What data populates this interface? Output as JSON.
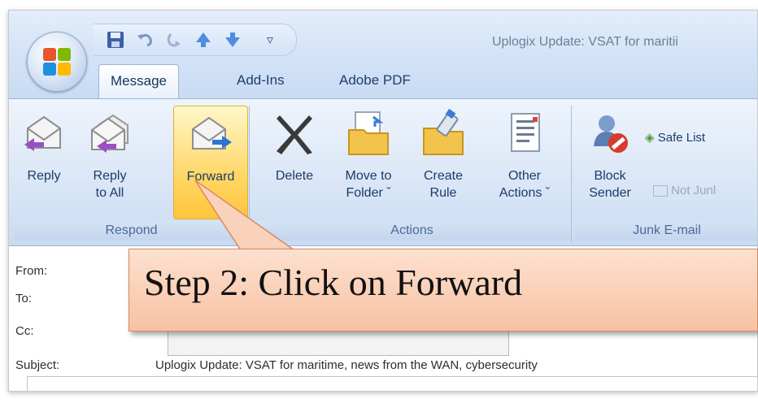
{
  "window": {
    "title": "Uplogix Update: VSAT for maritii"
  },
  "quick_access": {
    "icons": [
      "save-icon",
      "undo-icon",
      "redo-icon",
      "previous-item-icon",
      "next-item-icon",
      "customize-qat-icon"
    ],
    "customize_glyph": "▿"
  },
  "tabs": [
    {
      "label": "Message",
      "active": true
    },
    {
      "label": "Add-Ins",
      "active": false
    },
    {
      "label": "Adobe PDF",
      "active": false
    }
  ],
  "ribbon": {
    "respond": {
      "label": "Respond",
      "reply": "Reply",
      "reply_all": "Reply\nto All",
      "forward": "Forward"
    },
    "actions": {
      "label": "Actions",
      "delete": "Delete",
      "move_to_folder": "Move to\nFolder ˇ",
      "create_rule": "Create\nRule",
      "other_actions": "Other\nActions ˇ"
    },
    "junk": {
      "label": "Junk E-mail",
      "block_sender": "Block\nSender",
      "safe_lists": "Safe List",
      "not_junk": "Not Junl"
    }
  },
  "header": {
    "from_label": "From:",
    "to_label": "To:",
    "cc_label": "Cc:",
    "subject_label": "Subject:",
    "subject_value": "Uplogix Update: VSAT for maritime, news from the WAN, cybersecurity"
  },
  "callout": {
    "text": "Step 2: Click on Forward"
  },
  "colors": {
    "ribbon_bg": "#dbe7f7",
    "highlight": "#ffd86a",
    "callout_fill": "#f9cbb0",
    "callout_border": "#d78a5f"
  }
}
